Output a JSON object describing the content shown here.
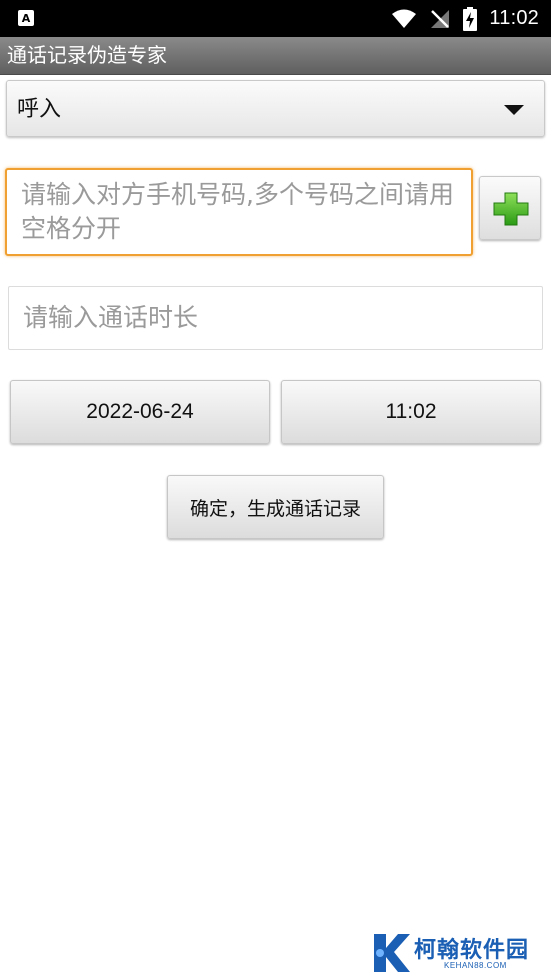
{
  "status_bar": {
    "time": "11:02",
    "notification_icon": "text-a-icon",
    "icons": [
      "wifi-icon",
      "no-signal-icon",
      "battery-charging-icon"
    ]
  },
  "app": {
    "title": "通话记录伪造专家"
  },
  "call_type": {
    "selected": "呼入",
    "icon": "dropdown-arrow-icon"
  },
  "phone": {
    "placeholder": "请输入对方手机号码,多个号码之间请用空格分开",
    "add_icon": "plus-icon",
    "accent_color": "#f0a030"
  },
  "duration": {
    "placeholder": "请输入通话时长"
  },
  "date_button": {
    "label": "2022-06-24"
  },
  "time_button": {
    "label": "11:02"
  },
  "confirm_button": {
    "label": "确定，生成通话记录"
  },
  "watermark": {
    "name": "柯翰软件园",
    "url": "KEHAN88.COM"
  }
}
